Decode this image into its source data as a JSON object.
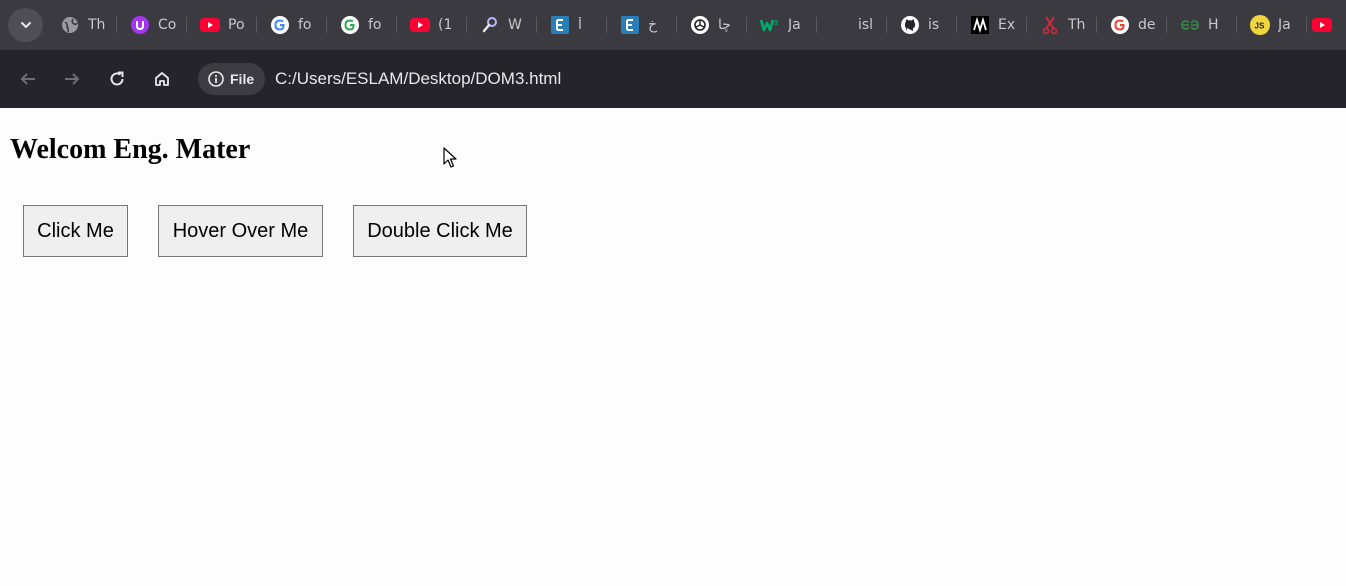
{
  "tabs": [
    {
      "icon": "globe-icon",
      "title": "Th"
    },
    {
      "icon": "udemy-icon",
      "title": "Co"
    },
    {
      "icon": "youtube-icon",
      "title": "Po"
    },
    {
      "icon": "google-icon",
      "title": "fo"
    },
    {
      "icon": "google-icon",
      "title": "fo"
    },
    {
      "icon": "youtube-icon",
      "title": "(1"
    },
    {
      "icon": "tool-icon",
      "title": "W"
    },
    {
      "icon": "e-letter-icon",
      "title": "أ"
    },
    {
      "icon": "e-letter-icon",
      "title": "خ"
    },
    {
      "icon": "openai-icon",
      "title": "چا"
    },
    {
      "icon": "w3schools-icon",
      "title": "Ja"
    },
    {
      "icon": "blank-icon",
      "title": "isl"
    },
    {
      "icon": "github-icon",
      "title": "is"
    },
    {
      "icon": "m-logo-icon",
      "title": "Ex"
    },
    {
      "icon": "scissors-icon",
      "title": "Th"
    },
    {
      "icon": "google-icon",
      "title": "de"
    },
    {
      "icon": "geeksforgeeks-icon",
      "title": "H"
    },
    {
      "icon": "js-icon",
      "title": "Ja"
    },
    {
      "icon": "youtube-icon",
      "title": ""
    }
  ],
  "toolbar": {
    "site_chip_label": "File",
    "url": "C:/Users/ESLAM/Desktop/DOM3.html"
  },
  "page": {
    "heading": "Welcom Eng. Mater",
    "buttons": {
      "click": "Click Me",
      "hover": "Hover Over Me",
      "dblclick": "Double Click Me"
    }
  },
  "colors": {
    "tabstrip_bg": "#3b3a40",
    "toolbar_bg": "#25242a",
    "page_bg": "#fdfdfd",
    "button_bg": "#efefef",
    "button_border": "#767676"
  }
}
